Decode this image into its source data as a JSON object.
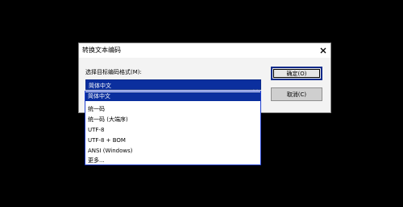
{
  "dialog": {
    "title": "转换文本编码",
    "prompt": "选择目标编码格式(M):",
    "selected_value": "简体中文",
    "ok_label": "确定(O)",
    "cancel_label": "取消(C)"
  },
  "dropdown": {
    "options": [
      "简体中文",
      "统一码",
      "统一码 (大端序)",
      "UTF-8",
      "UTF-8 + BOM",
      "ANSI (Windows)",
      "更多..."
    ],
    "selected_index": 0
  },
  "icons": {
    "close": "close-icon",
    "dropdown_arrow": "chevron-down-icon"
  },
  "colors": {
    "selection": "#0b2f9e",
    "dropdown_border": "#1e3fd0",
    "background": "#000000"
  }
}
